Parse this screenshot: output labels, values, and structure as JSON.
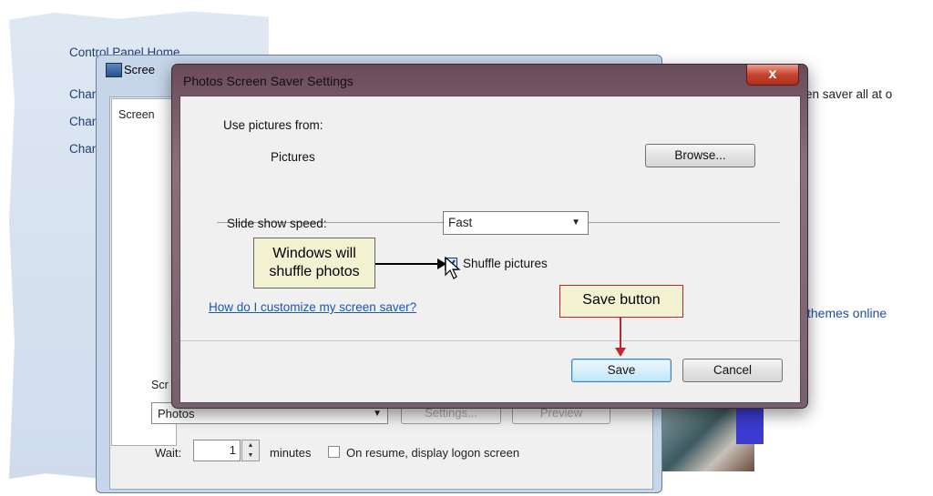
{
  "control_panel": {
    "home_link": "Control Panel Home",
    "side_links": [
      "Chang",
      "Chang",
      "Chang"
    ],
    "right_text": "en saver all at o",
    "themes_link": "themes online"
  },
  "screen_saver_window": {
    "title": "Scree",
    "tab_label": "Screen",
    "group_label": "Scr",
    "selected_saver": "Photos",
    "settings_label": "Settings...",
    "preview_label": "Preview",
    "wait_label": "Wait:",
    "wait_value": "1",
    "minutes_label": "minutes",
    "resume_label": "On resume, display logon screen"
  },
  "dialog": {
    "title": "Photos Screen Saver Settings",
    "close_label": "x",
    "use_pictures_label": "Use pictures from:",
    "pictures_folder": "Pictures",
    "browse_label": "Browse...",
    "slide_speed_label": "Slide show speed:",
    "slide_speed_value": "Fast",
    "shuffle_label": "Shuffle pictures",
    "shuffle_checked": true,
    "help_link": "How do I customize my screen saver?",
    "save_label": "Save",
    "cancel_label": "Cancel"
  },
  "callouts": {
    "shuffle_note": "Windows will shuffle photos",
    "save_note": "Save button"
  },
  "colors": {
    "dialog_frame": "#8d6f7d",
    "close_button": "#c7452f",
    "link": "#1a56b5",
    "callout_bg": "#f2f2d2",
    "callout_red": "#c0262d"
  }
}
